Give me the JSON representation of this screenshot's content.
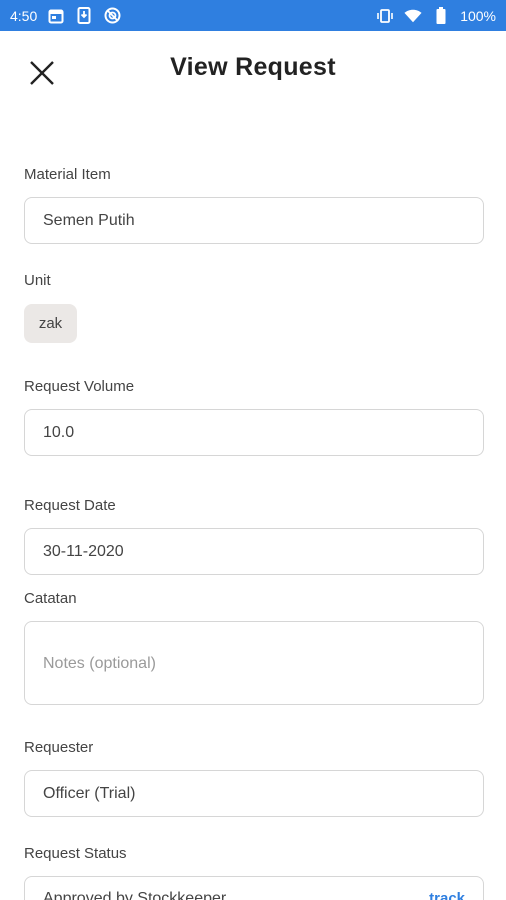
{
  "status_bar": {
    "time": "4:50",
    "battery": "100%",
    "background": "#2f7fe0"
  },
  "header": {
    "title": "View Request"
  },
  "form": {
    "material_item": {
      "label": "Material Item",
      "value": "Semen Putih"
    },
    "unit": {
      "label": "Unit",
      "value": "zak"
    },
    "request_volume": {
      "label": "Request Volume",
      "value": "10.0"
    },
    "request_date": {
      "label": "Request Date",
      "value": "30-11-2020"
    },
    "notes": {
      "label": "Catatan",
      "placeholder": "Notes (optional)"
    },
    "requester": {
      "label": "Requester",
      "value": "Officer (Trial)"
    },
    "request_status": {
      "label": "Request Status",
      "value": "Approved by Stockkeeper",
      "track_label": "track"
    }
  },
  "colors": {
    "accent": "#2f7fe0",
    "chip_bg": "#ebe8e6",
    "border": "#d6d6d6"
  }
}
